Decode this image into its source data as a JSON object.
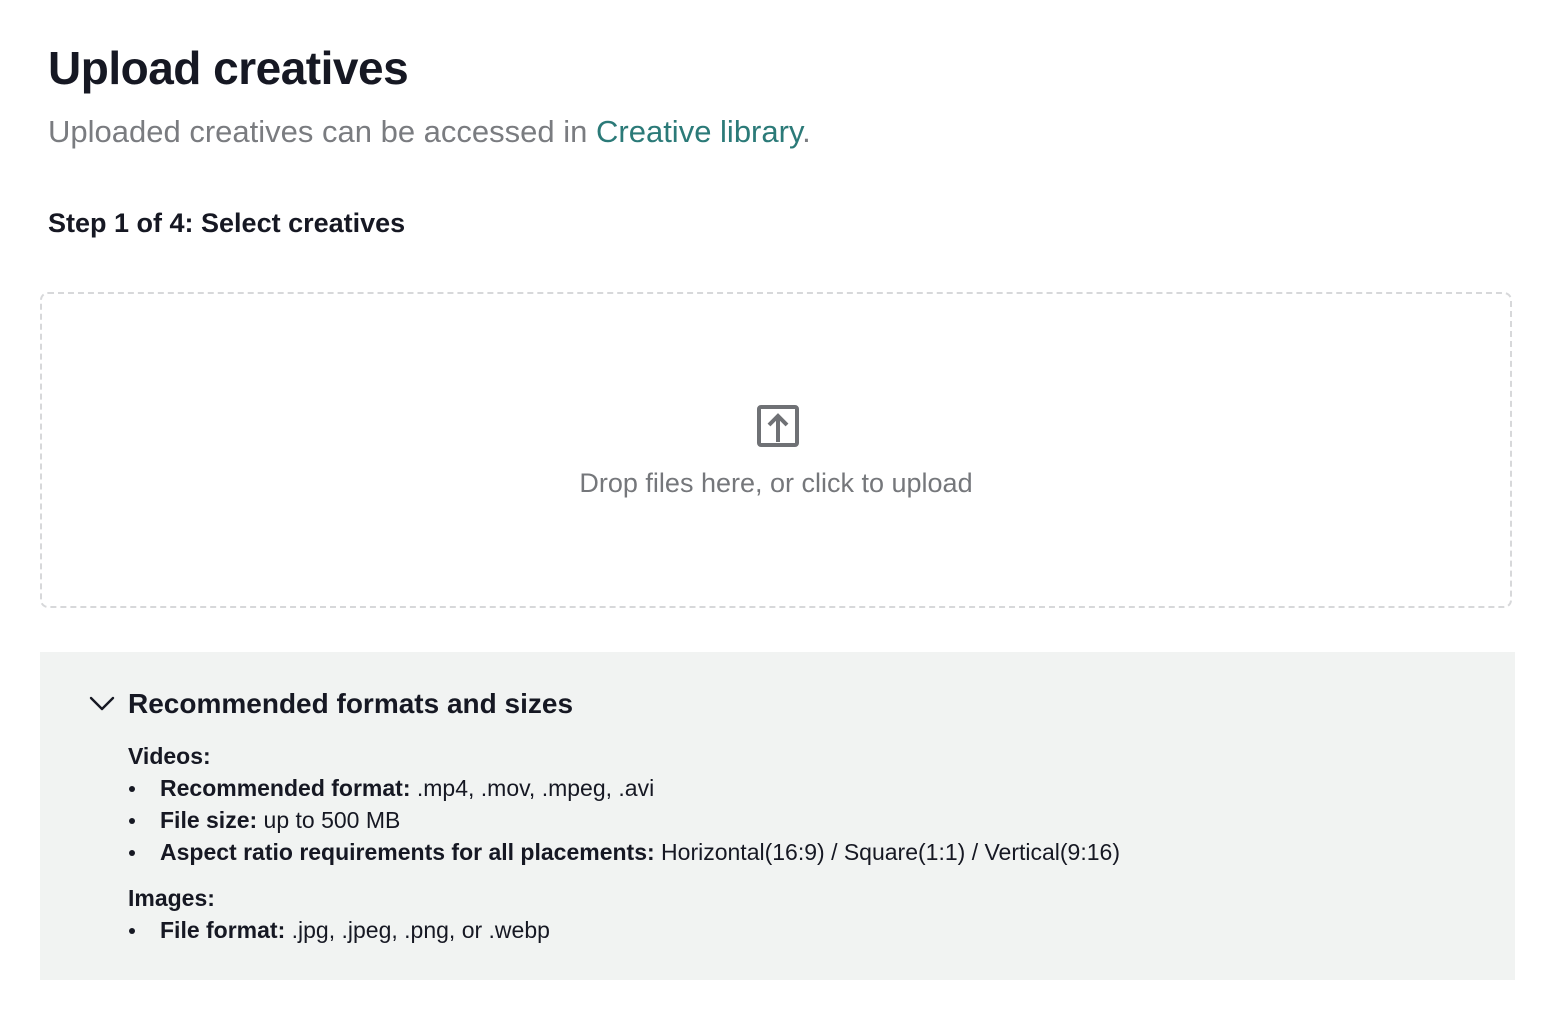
{
  "header": {
    "title": "Upload creatives",
    "subtitle_prefix": "Uploaded creatives can be accessed in ",
    "library_link": "Creative library",
    "subtitle_suffix": "."
  },
  "step": {
    "label": "Step 1 of 4: Select creatives"
  },
  "dropzone": {
    "icon": "upload-icon",
    "text": "Drop files here, or click to upload"
  },
  "formats": {
    "icon": "chevron-down-icon",
    "title": "Recommended formats and sizes",
    "videos": {
      "title": "Videos:",
      "items": [
        {
          "label": "Recommended format:",
          "value": " .mp4, .mov, .mpeg, .avi"
        },
        {
          "label": "File size:",
          "value": " up to 500 MB"
        },
        {
          "label": "Aspect ratio requirements for all placements:",
          "value": " Horizontal(16:9) / Square(1:1) / Vertical(9:16)"
        }
      ]
    },
    "images": {
      "title": "Images:",
      "items": [
        {
          "label": "File format:",
          "value": " .jpg, .jpeg, .png, or .webp"
        }
      ]
    }
  },
  "colors": {
    "link": "#2b7a78",
    "panel_bg": "#f1f3f2",
    "muted_text": "#7a7c80"
  }
}
